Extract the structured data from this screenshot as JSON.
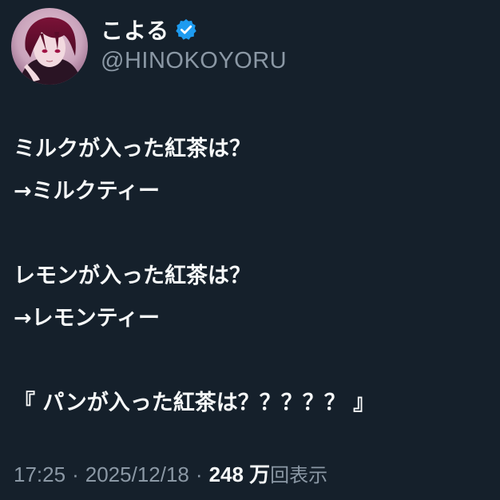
{
  "author": {
    "display_name": "こよる",
    "handle": "@HINOKOYORU",
    "verified": true,
    "avatar_icon": "avatar-anime-character",
    "verified_icon": "verified-badge-icon",
    "verified_color": "#1d9bf0"
  },
  "tweet": {
    "lines": [
      "ミルクが入った紅茶は？",
      "→ミルクティー",
      "",
      "レモンが入った紅茶は？",
      "→レモンティー",
      "",
      "『 パンが入った紅茶は？？？？？ 』"
    ]
  },
  "meta": {
    "time": "17:25",
    "separator": "·",
    "date": "2025/12/18",
    "views_count": "248 万",
    "views_label": "回表示"
  },
  "colors": {
    "background": "#15202b",
    "text_primary": "#f7f9f9",
    "text_secondary": "#8b98a5"
  }
}
